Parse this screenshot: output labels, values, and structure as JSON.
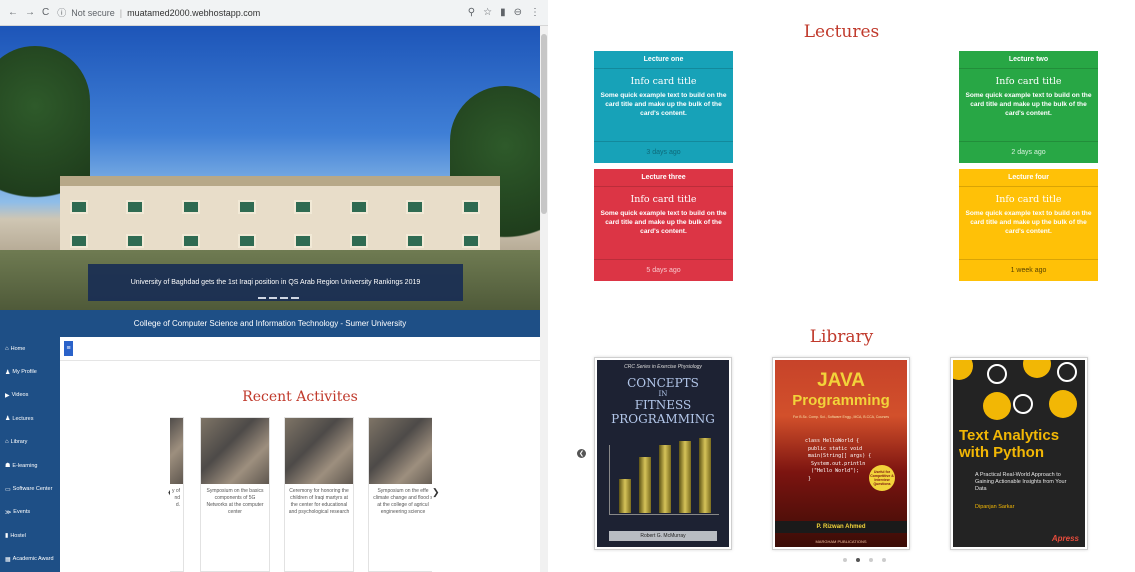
{
  "browser": {
    "security": "Not secure",
    "url": "muatamed2000.webhostapp.com"
  },
  "hero": {
    "caption": "University of Baghdad gets the 1st Iraqi position in QS Arab Region University Rankings 2019",
    "slide_count": 4,
    "active_slide": 2
  },
  "site_title": "College of Computer Science and Information Technology - Sumer University",
  "sidebar": {
    "items": [
      {
        "label": "Home",
        "icon": "home-icon",
        "glyph": "⌂"
      },
      {
        "label": "My Profile",
        "icon": "user-icon",
        "glyph": "♟"
      },
      {
        "label": "Videos",
        "icon": "video-icon",
        "glyph": "▶"
      },
      {
        "label": "Lectures",
        "icon": "users-icon",
        "glyph": "♟"
      },
      {
        "label": "Library",
        "icon": "library-icon",
        "glyph": "⌂"
      },
      {
        "label": "E-learning",
        "icon": "graduation-icon",
        "glyph": "☗"
      },
      {
        "label": "Software Center",
        "icon": "monitor-icon",
        "glyph": "▭"
      },
      {
        "label": "Events",
        "icon": "share-icon",
        "glyph": "≫"
      },
      {
        "label": "Hostel",
        "icon": "building-icon",
        "glyph": "▮"
      },
      {
        "label": "Academic Award",
        "icon": "award-icon",
        "glyph": "▦"
      }
    ]
  },
  "recent": {
    "title": "Recent Activites",
    "items": [
      {
        "text": "y of\nnd\nd."
      },
      {
        "text": "Symposium on the basics components of 5G Networks at the computer center"
      },
      {
        "text": "Ceremony for honoring the children of Iraqi martyrs at the center for educational and psychological research"
      },
      {
        "text": "Symposium on the effe climate change and flood s at the college of agricul engineering science"
      }
    ]
  },
  "lectures": {
    "title": "Lectures",
    "cards": [
      {
        "header": "Lecture one",
        "title": "Info card title",
        "text": "Some quick example text to build on the card title and make up the bulk of the card's content.",
        "footer": "3 days ago",
        "color": "#17a2b8"
      },
      {
        "header": "Lecture two",
        "title": "Info card title",
        "text": "Some quick example text to build on the card title and make up the bulk of the card's content.",
        "footer": "2 days ago",
        "color": "#28a745"
      },
      {
        "header": "Lecture three",
        "title": "Info card title",
        "text": "Some quick example text to build on the card title and make up the bulk of the card's content.",
        "footer": "5 days ago",
        "color": "#dc3545"
      },
      {
        "header": "Lecture four",
        "title": "Info card title",
        "text": "Some quick example text to build on the card title and make up the bulk of the card's content.",
        "footer": "1 week ago",
        "color": "#ffc107"
      }
    ]
  },
  "library": {
    "title": "Library",
    "books": [
      {
        "series": "CRC Series in Exercise Physiology",
        "title_l1": "CONCEPTS",
        "title_l2": "IN",
        "title_l3": "FITNESS",
        "title_l4": "PROGRAMMING",
        "author": "Robert G. McMurray"
      },
      {
        "title_l1": "JAVA",
        "title_l2": "Programming",
        "subtitle": "For B.Sc. Comp. Sci., Software Engg., MCA, B.CCA, Courses",
        "code": "class HelloWorld {\n public static void\n main(String[] args) {\n  System.out.println\n  (\"Hello World\");\n }",
        "badge": "Useful for Competitive & Interview Questions",
        "author": "P. Rizwan Ahmed",
        "publisher": "MARGHAM PUBLICATIONS"
      },
      {
        "title_l1": "Text Analytics",
        "title_l2": "with Python",
        "subtitle": "A Practical Real-World Approach to Gaining Actionable Insights from Your Data",
        "author": "Dipanjan Sarkar",
        "publisher": "Apress"
      }
    ],
    "page_count": 4,
    "active_page": 2
  }
}
